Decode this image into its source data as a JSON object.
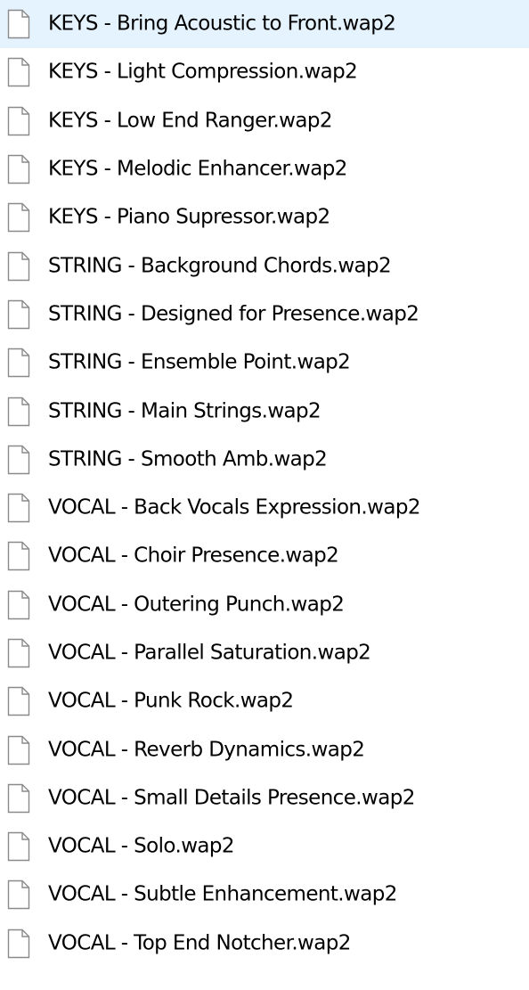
{
  "file_list": {
    "icon": "blank-file-icon",
    "items": [
      {
        "name": "KEYS - Bring Acoustic to Front.wap2"
      },
      {
        "name": "KEYS - Light Compression.wap2"
      },
      {
        "name": "KEYS - Low End Ranger.wap2"
      },
      {
        "name": "KEYS - Melodic Enhancer.wap2"
      },
      {
        "name": "KEYS - Piano Supressor.wap2"
      },
      {
        "name": "STRING - Background Chords.wap2"
      },
      {
        "name": "STRING - Designed for Presence.wap2"
      },
      {
        "name": "STRING - Ensemble Point.wap2"
      },
      {
        "name": "STRING - Main Strings.wap2"
      },
      {
        "name": "STRING - Smooth Amb.wap2"
      },
      {
        "name": "VOCAL - Back Vocals Expression.wap2"
      },
      {
        "name": "VOCAL - Choir Presence.wap2"
      },
      {
        "name": "VOCAL - Outering Punch.wap2"
      },
      {
        "name": "VOCAL - Parallel Saturation.wap2"
      },
      {
        "name": "VOCAL - Punk Rock.wap2"
      },
      {
        "name": "VOCAL - Reverb Dynamics.wap2"
      },
      {
        "name": "VOCAL - Small Details Presence.wap2"
      },
      {
        "name": "VOCAL - Solo.wap2"
      },
      {
        "name": "VOCAL - Subtle Enhancement.wap2"
      },
      {
        "name": "VOCAL - Top End Notcher.wap2"
      }
    ]
  }
}
